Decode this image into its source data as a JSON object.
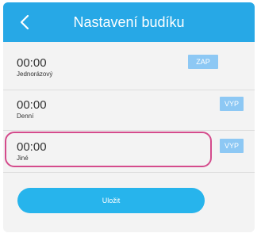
{
  "header": {
    "title": "Nastavení budíku"
  },
  "alarms": [
    {
      "time": "00:00",
      "repeat": "Jednorázový",
      "toggle": "ZAP"
    },
    {
      "time": "00:00",
      "repeat": "Denní",
      "toggle": "VYP"
    },
    {
      "time": "00:00",
      "repeat": "Jiné",
      "toggle": "VYP"
    }
  ],
  "actions": {
    "save_label": "Uložit"
  },
  "colors": {
    "header": "#27a8e6",
    "toggle": "#8dc8f4",
    "save": "#27b4ec",
    "highlight": "#d44b8c",
    "background": "#f3f3f3"
  },
  "icons": {
    "back": "back-arrow-icon"
  }
}
